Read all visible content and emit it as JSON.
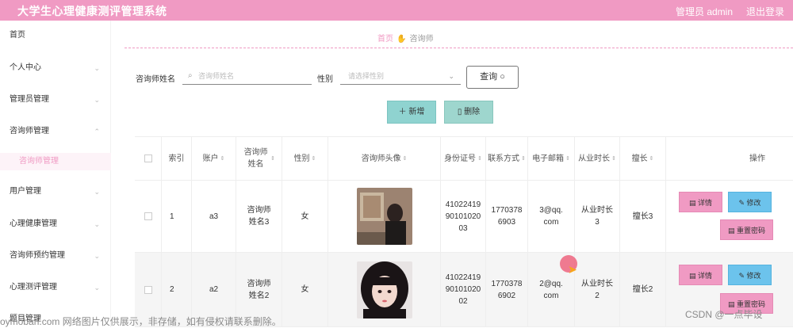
{
  "header": {
    "title": "大学生心理健康测评管理系统",
    "user": "管理员 admin",
    "logout": "退出登录"
  },
  "sidebar": {
    "items": [
      {
        "label": "首页",
        "chevron": false
      },
      {
        "label": "个人中心",
        "chevron": true
      },
      {
        "label": "管理员管理",
        "chevron": true
      },
      {
        "label": "咨询师管理",
        "chevron": true
      },
      {
        "label": "咨询师管理",
        "chevron": false
      },
      {
        "label": "用户管理",
        "chevron": true
      },
      {
        "label": "心理健康管理",
        "chevron": true
      },
      {
        "label": "咨询师预约管理",
        "chevron": true
      },
      {
        "label": "心理测评管理",
        "chevron": true
      },
      {
        "label": "题目管理",
        "chevron": false
      }
    ]
  },
  "breadcrumb": {
    "home": "首页",
    "current": "咨询师"
  },
  "search": {
    "name_label": "咨询师姓名",
    "name_placeholder": "咨询师姓名",
    "gender_label": "性别",
    "gender_placeholder": "请选择性别",
    "query_button": "查询"
  },
  "actions": {
    "add": "新增",
    "delete": "删除"
  },
  "table": {
    "headers": [
      "索引",
      "账户",
      "咨询师姓名",
      "性别",
      "咨询师头像",
      "身份证号",
      "联系方式",
      "电子邮箱",
      "从业时长",
      "擅长",
      "操作"
    ],
    "rows": [
      {
        "index": "1",
        "account": "a3",
        "name": "咨询师姓名3",
        "gender": "女",
        "id_card": "410224199010102003",
        "phone": "17703786903",
        "email": "3@qq.com",
        "years": "从业时长3",
        "specialty": "擅长3"
      },
      {
        "index": "2",
        "account": "a2",
        "name": "咨询师姓名2",
        "gender": "女",
        "id_card": "410224199010102002",
        "phone": "17703786902",
        "email": "2@qq.com",
        "years": "从业时长2",
        "specialty": "擅长2"
      }
    ],
    "row_buttons": {
      "detail": "详情",
      "edit": "修改",
      "reset": "重置密码"
    }
  },
  "overlay": {
    "watermark": "oymoban.com 网络图片仅供展示，非存储，如有侵权请联系删除。",
    "csdn": "CSDN @一点毕设"
  },
  "colors": {
    "brand_pink": "#f09ac3",
    "teal": "#8fd3d0",
    "blue": "#6cc3ec"
  },
  "icons": [
    "search-icon",
    "chevron-icon",
    "plus-icon",
    "trash-icon",
    "doc-icon",
    "pencil-icon",
    "hand-icon"
  ]
}
